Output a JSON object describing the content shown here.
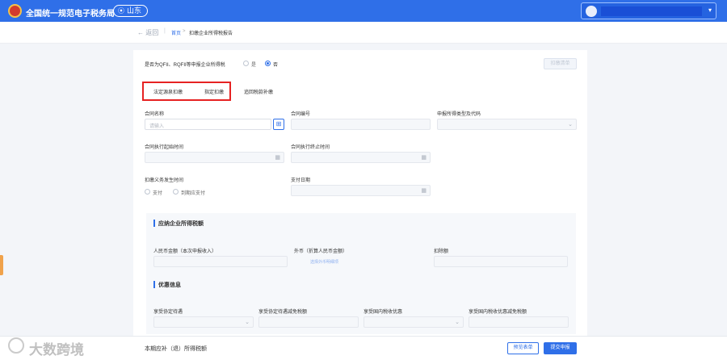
{
  "header": {
    "site_title": "全国统一规范电子税务局",
    "region": "山东",
    "region_icon": "map-pin-icon",
    "colors": {
      "primary": "#2f6fe8",
      "highlight": "#e62222"
    }
  },
  "breadcrumb": {
    "back_label": "返回",
    "home": "首页",
    "separator": ">",
    "current": "扣缴企业所得税报告"
  },
  "form": {
    "qfii_question": "是否为QFII、RQFII等申报企业所得税",
    "qfii_yes": "是",
    "qfii_no": "否",
    "qfii_selected": "否",
    "disabled_button": "扣缴清单",
    "type_options": [
      "法定源泉扣缴",
      "指定扣缴",
      "追回税款补缴"
    ],
    "contract_name_label": "合同名称",
    "contract_name_placeholder": "请输入",
    "contract_no_label": "合同编号",
    "income_type_label": "申报所得类型及代码",
    "exec_start_label": "合同执行起始时间",
    "exec_end_label": "合同执行终止时间",
    "obligation_time_label": "扣缴义务发生时间",
    "obligation_opt1": "支付",
    "obligation_opt2": "到期应支付",
    "payment_date_label": "支付日期"
  },
  "income_section": {
    "title": "应纳企业所得税额",
    "rmb_amount_label": "人民币金额（本次申报收入）",
    "foreign_label": "外币（折算人民币金额）",
    "foreign_link": "选择外币明细项",
    "deduction_label": "扣除额"
  },
  "discount_section": {
    "title": "优惠信息",
    "fields": [
      "享受协定待遇",
      "享受协定待遇减免税额",
      "享受国内税收优惠",
      "享受国内税收优惠减免税额"
    ]
  },
  "footer": {
    "label": "本期应补（退）所得税额",
    "preview_button": "预览表单",
    "submit_button": "提交申报"
  },
  "watermark": {
    "text": "大数跨境"
  }
}
